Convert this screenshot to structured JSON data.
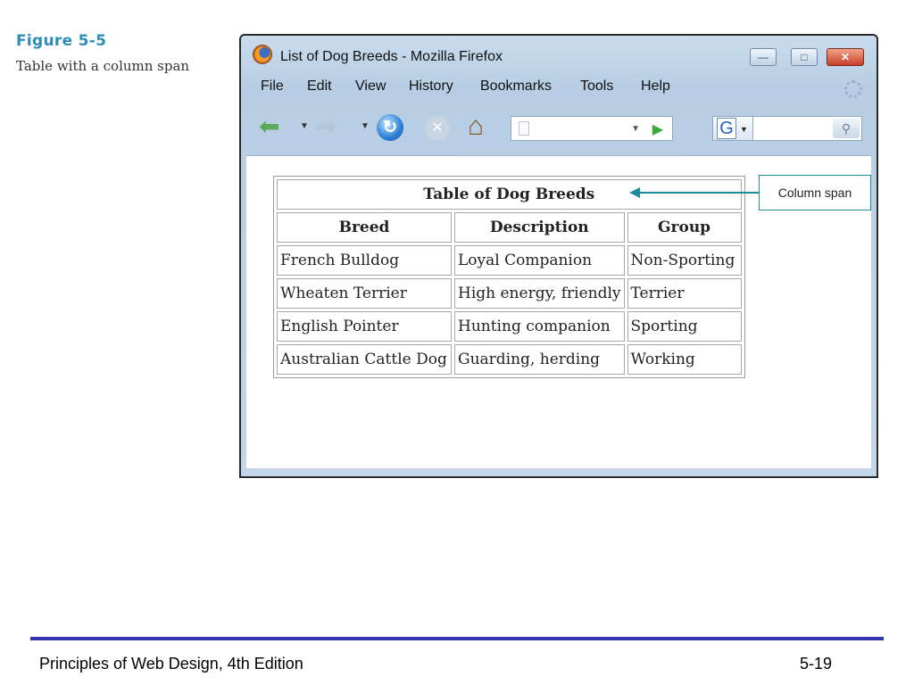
{
  "figure": {
    "label": "Figure 5-5",
    "caption": "Table with a column span"
  },
  "browser": {
    "title": "List of Dog Breeds - Mozilla Firefox",
    "window_buttons": {
      "minimize": "—",
      "maximize": "□",
      "close": "✕"
    },
    "menu": [
      {
        "label": "File"
      },
      {
        "label": "Edit"
      },
      {
        "label": "View"
      },
      {
        "label": "History"
      },
      {
        "label": "Bookmarks"
      },
      {
        "label": "Tools"
      },
      {
        "label": "Help"
      }
    ],
    "toolbar": {
      "back_icon": "back-arrow-icon",
      "forward_icon": "forward-arrow-icon",
      "reload_icon": "reload-icon",
      "stop_icon": "stop-icon",
      "home_icon": "home-icon",
      "url_value": "",
      "search_engine": "G",
      "search_value": ""
    }
  },
  "table": {
    "caption": "Table of Dog Breeds",
    "headers": [
      "Breed",
      "Description",
      "Group"
    ],
    "rows": [
      [
        "French Bulldog",
        "Loyal Companion",
        "Non-Sporting"
      ],
      [
        "Wheaten Terrier",
        "High energy, friendly",
        "Terrier"
      ],
      [
        "English Pointer",
        "Hunting companion",
        "Sporting"
      ],
      [
        "Australian Cattle Dog",
        "Guarding, herding",
        "Working"
      ]
    ]
  },
  "callout": {
    "label": "Column span"
  },
  "footer": {
    "left": "Principles of Web Design, 4th Edition",
    "right": "5-19"
  },
  "colors": {
    "figure_label": "#2e8db8",
    "callout": "#1a8a9c",
    "footer_rule": "#3333aa"
  }
}
